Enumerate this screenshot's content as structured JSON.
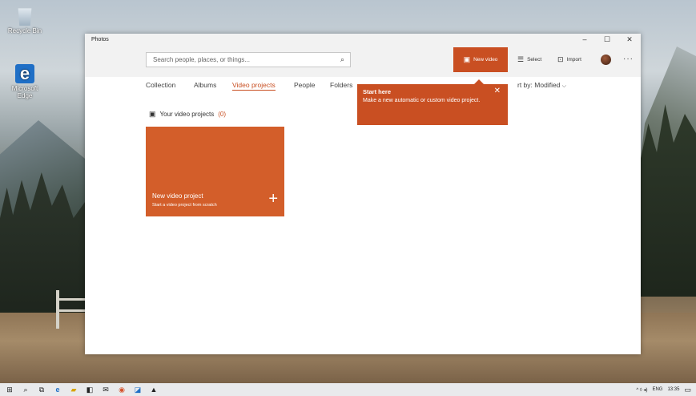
{
  "desktop": {
    "icons": [
      {
        "label": "Recycle Bin",
        "icon": "recycle-bin-icon"
      },
      {
        "label": "Microsoft Edge",
        "icon": "edge-icon"
      }
    ]
  },
  "window": {
    "title": "Photos",
    "controls": {
      "minimize": "–",
      "maximize": "☐",
      "close": "✕"
    }
  },
  "search": {
    "placeholder": "Search people, places, or things...",
    "icon": "search-icon"
  },
  "toolbar": {
    "new_video": "New video",
    "select": "Select",
    "import": "Import",
    "more": "···"
  },
  "tabs": [
    {
      "label": "Collection"
    },
    {
      "label": "Albums"
    },
    {
      "label": "Video projects",
      "active": true
    },
    {
      "label": "People"
    },
    {
      "label": "Folders"
    }
  ],
  "sort": {
    "label": "rt by:",
    "value": "Modified"
  },
  "section": {
    "title": "Your video projects",
    "count": "(0)"
  },
  "tile": {
    "title": "New video project",
    "subtitle": "Start a video project from scratch",
    "plus": "+"
  },
  "teaching_tip": {
    "title": "Start here",
    "body": "Make a new automatic or custom video project.",
    "close": "✕"
  },
  "taskbar": {
    "tray": {
      "language": "ENG",
      "time": "13:35",
      "indicators": "^ ◊ ◂)"
    }
  },
  "colors": {
    "accent": "#c94f22",
    "tile": "#d35e2a"
  }
}
